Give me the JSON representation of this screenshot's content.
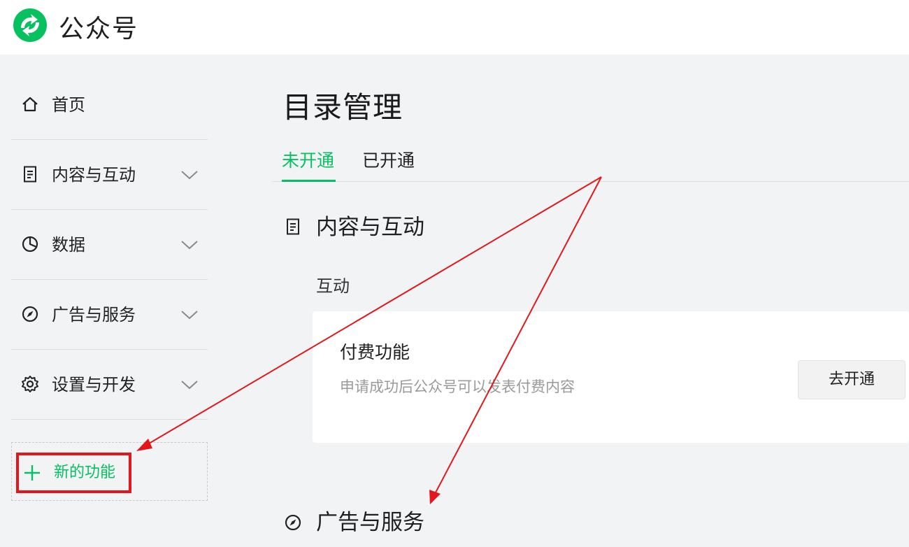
{
  "header": {
    "app_name": "公众号",
    "logo_icon": "wechat-official-account-logo",
    "brand_color": "#07c160"
  },
  "sidebar": {
    "items": [
      {
        "label": "首页",
        "icon": "home-icon",
        "expandable": false
      },
      {
        "label": "内容与互动",
        "icon": "document-icon",
        "expandable": true
      },
      {
        "label": "数据",
        "icon": "pie-chart-icon",
        "expandable": true
      },
      {
        "label": "广告与服务",
        "icon": "compass-icon",
        "expandable": true
      },
      {
        "label": "设置与开发",
        "icon": "gear-icon",
        "expandable": true
      }
    ],
    "new_feature": {
      "label": "新的功能",
      "icon": "plus-icon",
      "highlight_color": "#e3171b"
    }
  },
  "main": {
    "title": "目录管理",
    "tabs": [
      {
        "label": "未开通",
        "active": true
      },
      {
        "label": "已开通",
        "active": false
      }
    ],
    "sections": [
      {
        "title": "内容与互动",
        "icon": "document-icon",
        "subsection": "互动",
        "card": {
          "title": "付费功能",
          "description": "申请成功后公众号可以发表付费内容",
          "button": "去开通"
        }
      },
      {
        "title": "广告与服务",
        "icon": "compass-icon"
      }
    ]
  },
  "annotation": {
    "arrow_color": "#e3171b"
  }
}
